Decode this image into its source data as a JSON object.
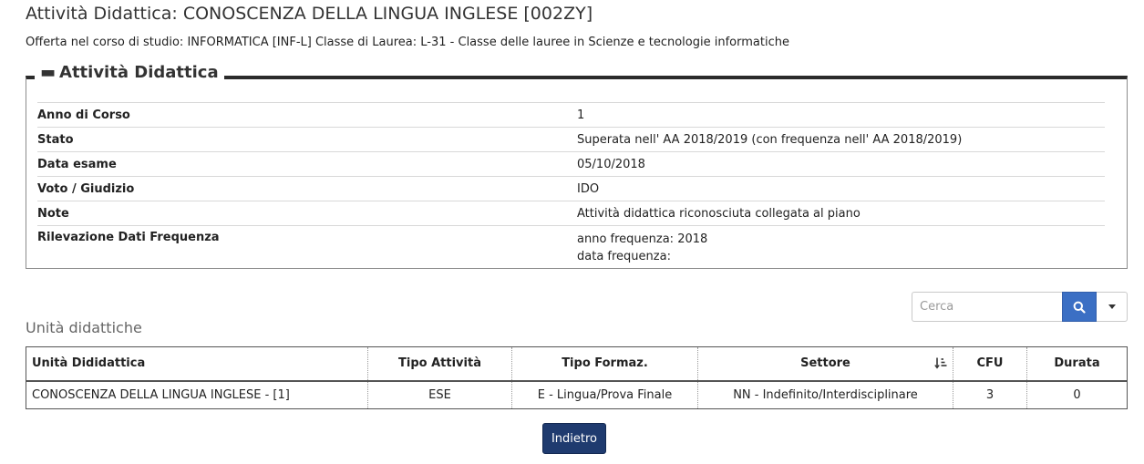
{
  "page": {
    "title": "Attività Didattica: CONOSCENZA DELLA LINGUA INGLESE [002ZY]",
    "offer": "Offerta nel corso di studio: INFORMATICA [INF-L] Classe di Laurea: L-31 - Classe delle lauree in Scienze e tecnologie informatiche"
  },
  "details": {
    "legend": "Attività Didattica",
    "rows": [
      {
        "label": "Anno di Corso",
        "value": "1"
      },
      {
        "label": "Stato",
        "value": "Superata nell' AA 2018/2019 (con frequenza nell' AA 2018/2019)"
      },
      {
        "label": "Data esame",
        "value": "05/10/2018"
      },
      {
        "label": "Voto / Giudizio",
        "value": "IDO"
      },
      {
        "label": "Note",
        "value": "Attività didattica riconosciuta collegata al piano"
      },
      {
        "label": "Rilevazione Dati Frequenza",
        "value": "anno frequenza: 2018",
        "value2": "data frequenza:"
      }
    ]
  },
  "search": {
    "placeholder": "Cerca",
    "button_icon": "search-icon",
    "dropdown_icon": "caret-down-icon"
  },
  "units": {
    "section_title": "Unità didattiche",
    "columns": [
      "Unità Dididattica",
      "Tipo Attività",
      "Tipo Formaz.",
      "Settore",
      "CFU",
      "Durata"
    ],
    "rows": [
      [
        "CONOSCENZA DELLA LINGUA INGLESE - [1]",
        "ESE",
        "E - Lingua/Prova Finale",
        "NN - Indefinito/Interdisciplinare",
        "3",
        "0"
      ]
    ]
  },
  "actions": {
    "back_label": "Indietro"
  },
  "colors": {
    "primary": "#1f3b6f",
    "search_button": "#3b6fc4"
  }
}
